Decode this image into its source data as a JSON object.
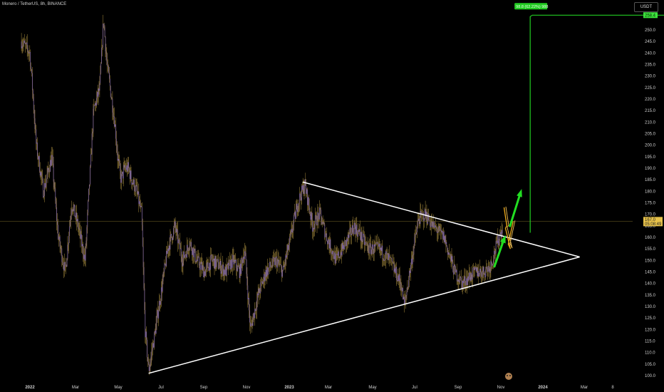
{
  "header": {
    "symbol": "Monero / TetherUS, 8h, BINANCE"
  },
  "currency": "USDT",
  "colors": {
    "background": "#000000",
    "candle": "#8a6fb0",
    "wick": "#c9a84a",
    "trendline": "#ffffff",
    "target": "#22cc22",
    "arrow": "#22dd22",
    "zigzag": "#e3a21a",
    "price_line": "#7a6a2a",
    "price_tag": "#e7c24a",
    "target_tag": "#3de33d"
  },
  "price_tag": {
    "price": "167.0",
    "timer": "05:08:49"
  },
  "target_tag": {
    "price": "258.4"
  },
  "target_box": {
    "label": "98.8 (62.22%) 988"
  },
  "chart_data": {
    "type": "candlestick",
    "y_axis": {
      "ticks": [
        100.0,
        105.0,
        110.0,
        115.0,
        120.0,
        125.0,
        130.0,
        135.0,
        140.0,
        145.0,
        150.0,
        155.0,
        160.0,
        165.0,
        170.0,
        175.0,
        180.0,
        185.0,
        190.0,
        195.0,
        200.0,
        205.0,
        210.0,
        215.0,
        220.0,
        225.0,
        230.0,
        235.0,
        240.0,
        245.0,
        250.0
      ],
      "range": [
        99,
        260
      ]
    },
    "x_axis": {
      "ticks": [
        "2022",
        "Mar",
        "May",
        "Jul",
        "Sep",
        "Nov",
        "2023",
        "Mar",
        "May",
        "Jul",
        "Sep",
        "Nov",
        "2024",
        "Mar",
        "8"
      ],
      "bold": [
        "2022",
        "2023",
        "2024"
      ]
    },
    "series": [
      {
        "values": [
          [
            "2021-12-20",
            245
          ],
          [
            "2022-01-01",
            240
          ],
          [
            "2022-01-10",
            200
          ],
          [
            "2022-01-20",
            180
          ],
          [
            "2022-02-01",
            195
          ],
          [
            "2022-02-10",
            160
          ],
          [
            "2022-02-20",
            145
          ],
          [
            "2022-03-01",
            175
          ],
          [
            "2022-03-10",
            165
          ],
          [
            "2022-03-20",
            150
          ],
          [
            "2022-04-01",
            215
          ],
          [
            "2022-04-10",
            225
          ],
          [
            "2022-04-15",
            255
          ],
          [
            "2022-04-20",
            235
          ],
          [
            "2022-05-01",
            210
          ],
          [
            "2022-05-05",
            195
          ],
          [
            "2022-05-10",
            185
          ],
          [
            "2022-05-15",
            190
          ],
          [
            "2022-05-20",
            190
          ],
          [
            "2022-05-25",
            185
          ],
          [
            "2022-06-01",
            180
          ],
          [
            "2022-06-08",
            170
          ],
          [
            "2022-06-13",
            120
          ],
          [
            "2022-06-18",
            102
          ],
          [
            "2022-06-25",
            115
          ],
          [
            "2022-07-05",
            135
          ],
          [
            "2022-07-15",
            155
          ],
          [
            "2022-07-25",
            165
          ],
          [
            "2022-08-05",
            150
          ],
          [
            "2022-08-15",
            158
          ],
          [
            "2022-08-25",
            150
          ],
          [
            "2022-09-05",
            145
          ],
          [
            "2022-09-15",
            150
          ],
          [
            "2022-09-25",
            148
          ],
          [
            "2022-10-05",
            145
          ],
          [
            "2022-10-15",
            150
          ],
          [
            "2022-10-25",
            145
          ],
          [
            "2022-11-01",
            155
          ],
          [
            "2022-11-09",
            120
          ],
          [
            "2022-11-20",
            135
          ],
          [
            "2022-12-01",
            145
          ],
          [
            "2022-12-15",
            150
          ],
          [
            "2022-12-25",
            145
          ],
          [
            "2023-01-05",
            160
          ],
          [
            "2023-01-15",
            175
          ],
          [
            "2023-01-25",
            183
          ],
          [
            "2023-02-05",
            165
          ],
          [
            "2023-02-15",
            170
          ],
          [
            "2023-02-25",
            160
          ],
          [
            "2023-03-10",
            150
          ],
          [
            "2023-03-25",
            158
          ],
          [
            "2023-04-05",
            165
          ],
          [
            "2023-04-15",
            160
          ],
          [
            "2023-04-25",
            155
          ],
          [
            "2023-05-10",
            155
          ],
          [
            "2023-05-25",
            150
          ],
          [
            "2023-06-10",
            140
          ],
          [
            "2023-06-15",
            130
          ],
          [
            "2023-06-25",
            150
          ],
          [
            "2023-07-05",
            168
          ],
          [
            "2023-07-15",
            170
          ],
          [
            "2023-07-25",
            165
          ],
          [
            "2023-08-10",
            160
          ],
          [
            "2023-08-20",
            150
          ],
          [
            "2023-08-25",
            145
          ],
          [
            "2023-09-05",
            140
          ],
          [
            "2023-09-15",
            143
          ],
          [
            "2023-09-25",
            145
          ],
          [
            "2023-10-05",
            145
          ],
          [
            "2023-10-15",
            148
          ],
          [
            "2023-10-25",
            158
          ],
          [
            "2023-11-01",
            165
          ]
        ]
      }
    ],
    "annotations": [
      {
        "type": "trendline",
        "points": [
          [
            "2023-01-22",
            184
          ],
          [
            "2024-02-18",
            151.5
          ]
        ]
      },
      {
        "type": "trendline",
        "points": [
          [
            "2022-06-18",
            101
          ],
          [
            "2024-02-18",
            151.5
          ]
        ]
      },
      {
        "type": "target",
        "from": [
          "2023-12-10",
          162
        ],
        "to": [
          "2024-09-20",
          256.4
        ]
      },
      {
        "type": "arrow",
        "points": [
          [
            "2023-10-20",
            147
          ],
          [
            "2023-11-05",
            161
          ]
        ]
      },
      {
        "type": "arrow",
        "points": [
          [
            "2023-11-11",
            164.5
          ],
          [
            "2023-11-28",
            181
          ]
        ]
      },
      {
        "type": "zigzag",
        "points": [
          [
            "2023-11-03",
            173
          ],
          [
            "2023-11-07",
            165
          ],
          [
            "2023-11-05",
            164
          ],
          [
            "2023-11-12",
            155
          ],
          [
            "2023-11-09",
            157
          ],
          [
            "2023-11-16",
            167
          ]
        ]
      }
    ],
    "last_price": 167.0
  }
}
